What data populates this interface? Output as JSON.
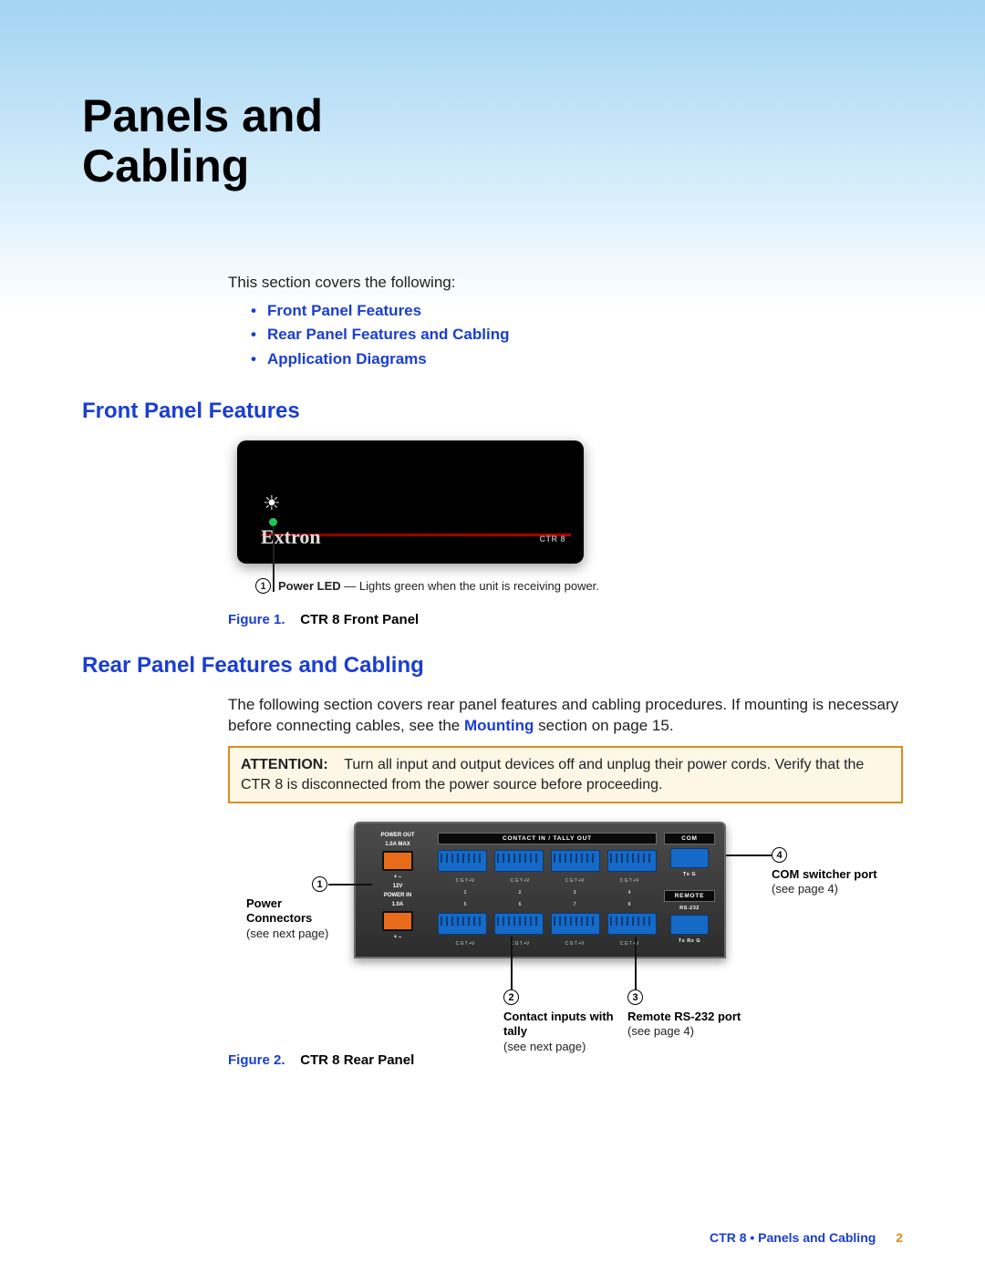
{
  "title_line1": "Panels and",
  "title_line2": "Cabling",
  "intro": "This section covers the following:",
  "toc": [
    "Front Panel Features",
    "Rear Panel Features and Cabling",
    "Application Diagrams"
  ],
  "section1_heading": "Front Panel Features",
  "front_panel": {
    "brand": "Extron",
    "model": "CTR 8",
    "callout_num": "1",
    "callout_bold": "Power LED",
    "callout_sep": " — ",
    "callout_text": "Lights green when the unit is receiving power."
  },
  "figure1_prefix": "Figure 1.",
  "figure1_title": "CTR 8 Front Panel",
  "section2_heading": "Rear Panel Features and Cabling",
  "rear_intro_a": "The following section covers rear panel features and cabling procedures. If mounting is necessary before connecting cables, see the ",
  "rear_intro_link": "Mounting",
  "rear_intro_b": " section on page 15.",
  "attention_label": "ATTENTION:",
  "attention_text": "Turn all input and output devices off and unplug their power cords. Verify that the CTR 8 is disconnected from the power source before proceeding.",
  "rear_panel": {
    "power_out": "POWER OUT",
    "max": "1.0A MAX",
    "pm": "+  –",
    "volts": "12V",
    "power_in": "POWER IN",
    "max2": "1.0A",
    "contact_bar": "CONTACT IN / TALLY OUT",
    "com_bar": "COM",
    "remote_bar": "REMOTE",
    "rs232": "RS-232",
    "pins_top": [
      "C G T +V",
      "C G T +V",
      "C G T +V",
      "C G T +V"
    ],
    "nums_top": [
      "1",
      "2",
      "3",
      "4"
    ],
    "nums_bot": [
      "5",
      "6",
      "7",
      "8"
    ],
    "pins_bot": [
      "C G T +V",
      "C G T +V",
      "C G T +V",
      "C G T +V"
    ],
    "txg": "Tx  G",
    "txrxg": "Tx  Rx  G"
  },
  "rear_callouts": {
    "c1_num": "1",
    "c1_title": "Power Connectors",
    "c1_sub": "(see next page)",
    "c2_num": "2",
    "c2_title": "Contact inputs with tally",
    "c2_sub": "(see next page)",
    "c3_num": "3",
    "c3_title": "Remote RS-232 port",
    "c3_sub": "(see page 4)",
    "c4_num": "4",
    "c4_title": "COM switcher port",
    "c4_sub": "(see page 4)"
  },
  "figure2_prefix": "Figure 2.",
  "figure2_title": "CTR 8 Rear Panel",
  "footer_text": "CTR 8 • Panels and Cabling",
  "footer_page": "2"
}
